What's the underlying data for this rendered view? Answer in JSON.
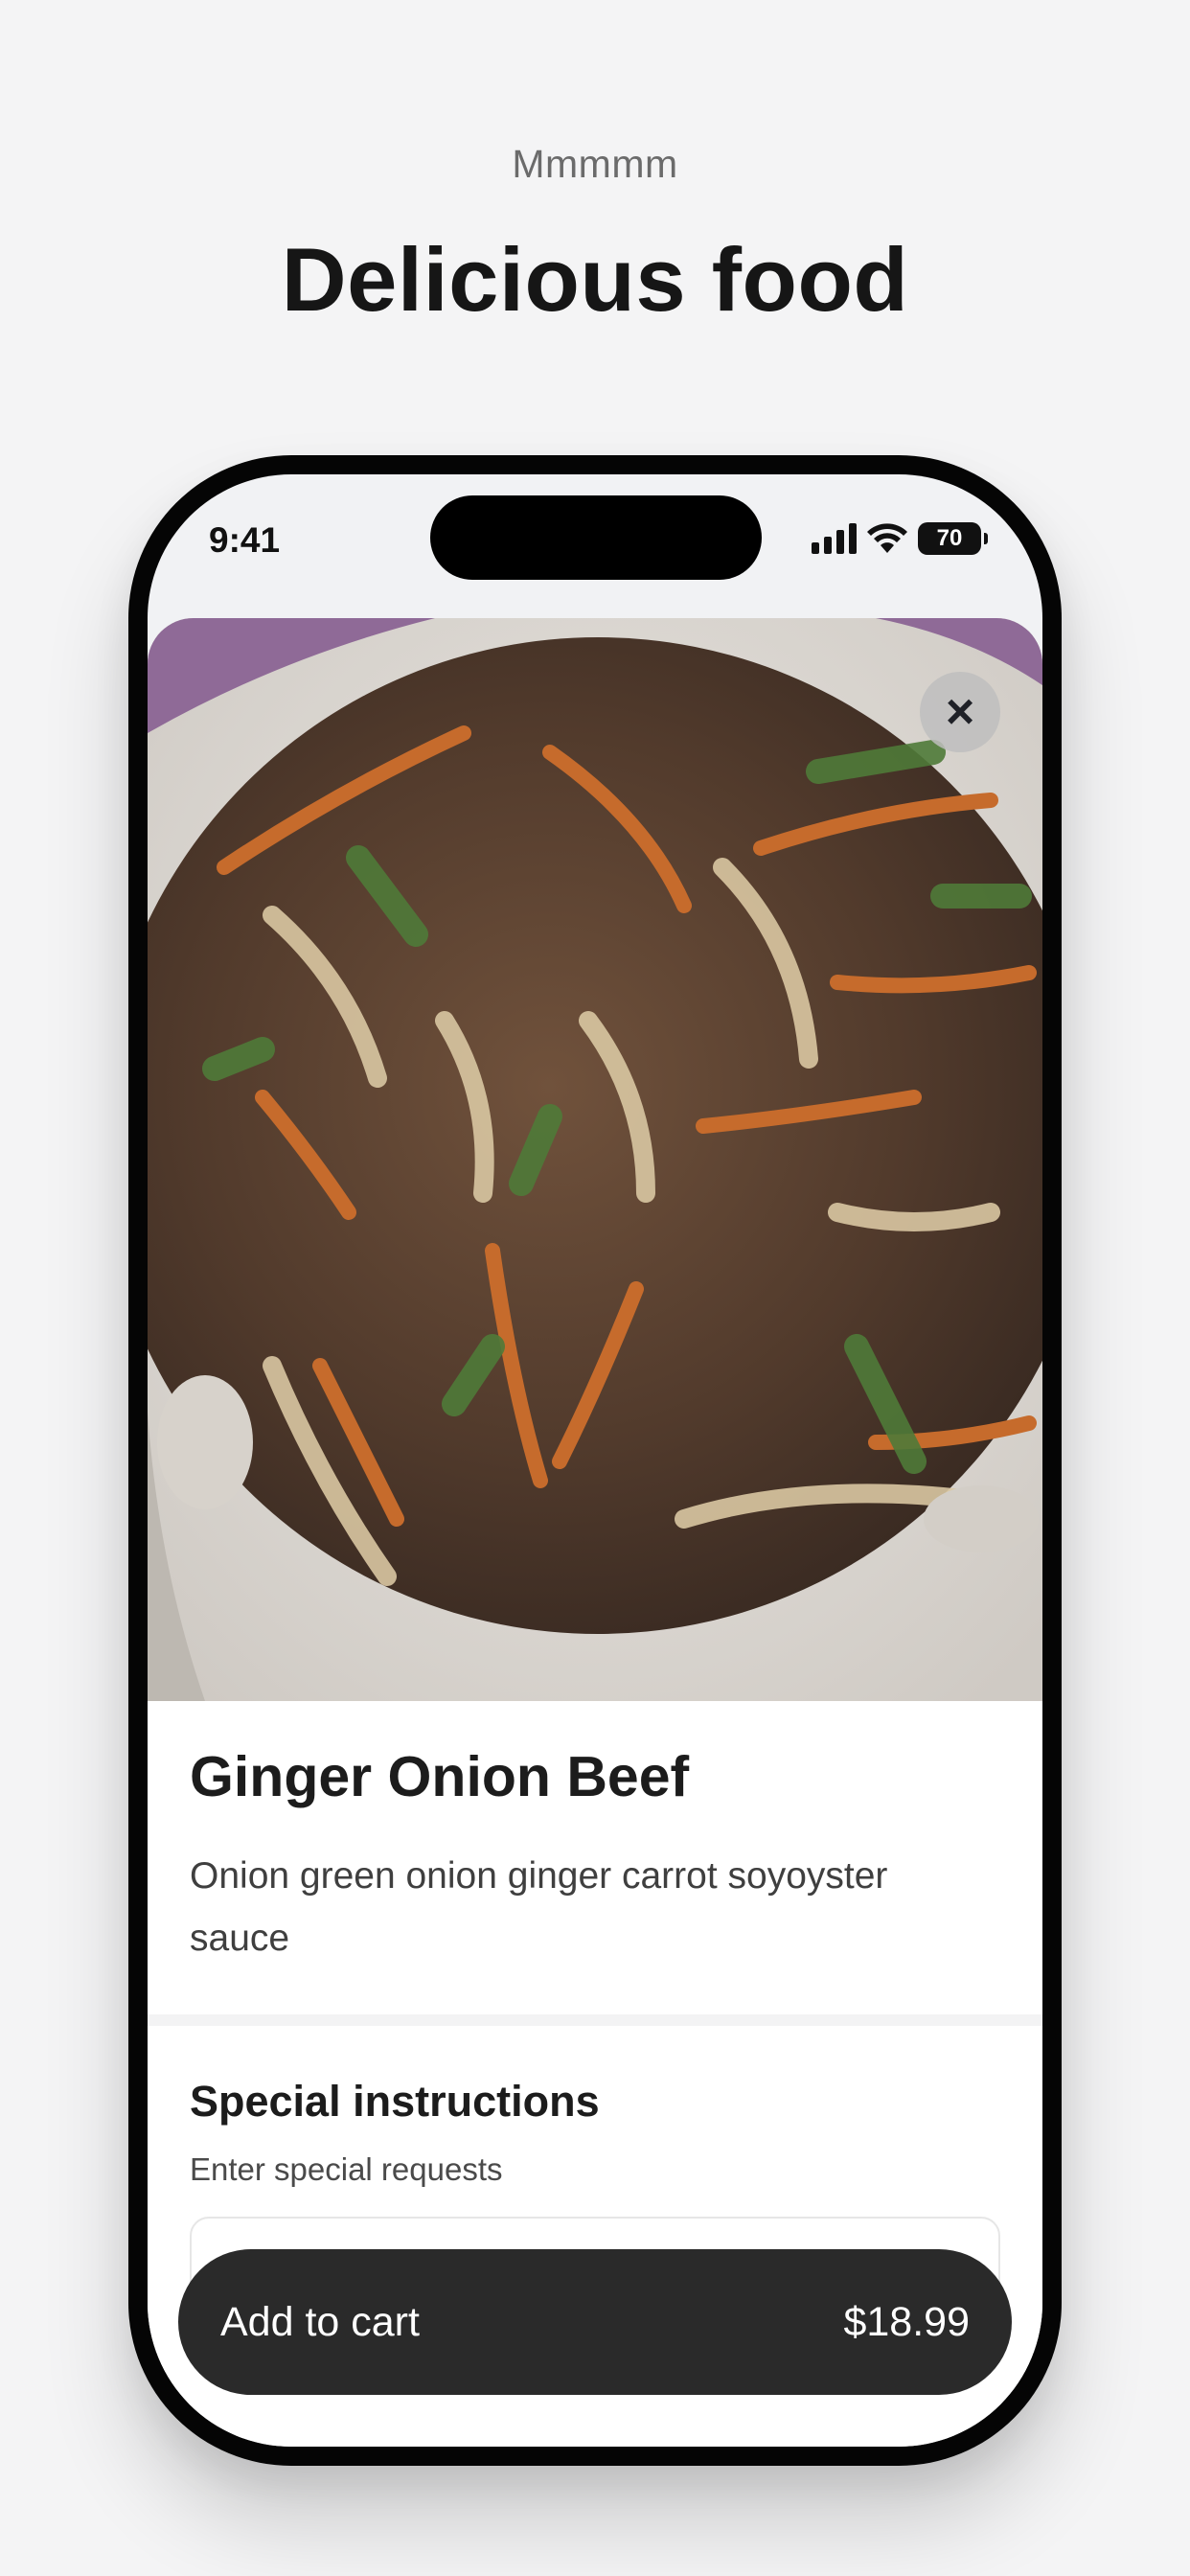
{
  "header": {
    "tagline": "Mmmmm",
    "headline": "Delicious food"
  },
  "status_bar": {
    "time": "9:41",
    "battery": "70",
    "icons": [
      "signal-icon",
      "wifi-icon",
      "battery-icon"
    ]
  },
  "item": {
    "close_icon": "close-icon",
    "title": "Ginger Onion Beef",
    "description": "Onion green onion ginger carrot soyoyster sauce"
  },
  "special_instructions": {
    "title": "Special instructions",
    "subtitle": "Enter special requests",
    "value": ""
  },
  "cart": {
    "label": "Add to cart",
    "price": "$18.99"
  },
  "colors": {
    "background": "#f4f4f5",
    "button": "#2a2a2a",
    "text": "#161616"
  }
}
